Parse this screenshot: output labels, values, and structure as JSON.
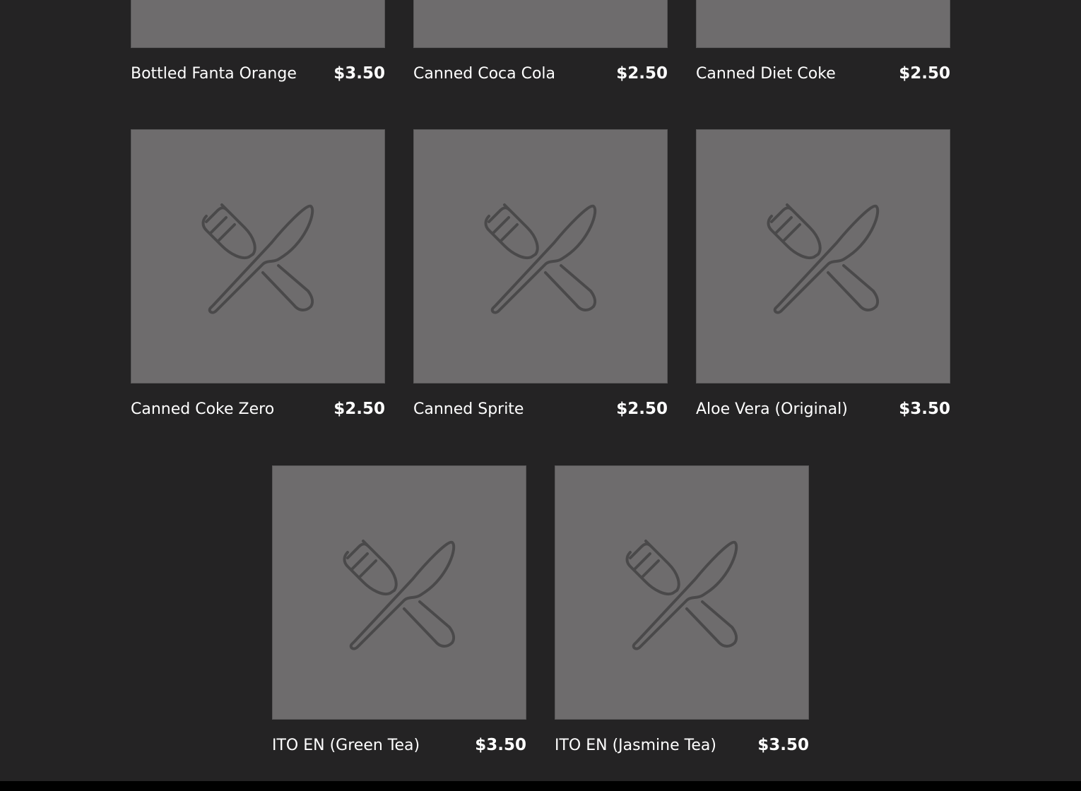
{
  "menu": {
    "items": [
      {
        "name": "Bottled Fanta Orange",
        "price": "$3.50",
        "icon": "utensils-placeholder-icon"
      },
      {
        "name": "Canned Coca Cola",
        "price": "$2.50",
        "icon": "utensils-placeholder-icon"
      },
      {
        "name": "Canned Diet Coke",
        "price": "$2.50",
        "icon": "utensils-placeholder-icon"
      },
      {
        "name": "Canned Coke Zero",
        "price": "$2.50",
        "icon": "utensils-placeholder-icon"
      },
      {
        "name": "Canned Sprite",
        "price": "$2.50",
        "icon": "utensils-placeholder-icon"
      },
      {
        "name": "Aloe Vera (Original)",
        "price": "$3.50",
        "icon": "utensils-placeholder-icon"
      },
      {
        "name": "ITO EN (Green Tea)",
        "price": "$3.50",
        "icon": "utensils-placeholder-icon"
      },
      {
        "name": "ITO EN (Jasmine Tea)",
        "price": "$3.50",
        "icon": "utensils-placeholder-icon"
      }
    ]
  },
  "colors": {
    "background": "#242324",
    "placeholder": "#6e6c6d",
    "icon_stroke": "#4a494a",
    "text": "#ffffff"
  }
}
